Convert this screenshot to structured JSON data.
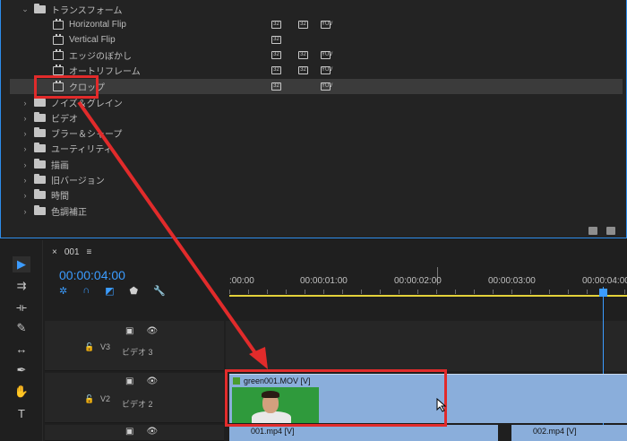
{
  "effects": {
    "folders_top": [
      {
        "label": "トランスフォーム",
        "expanded": true
      }
    ],
    "items": [
      {
        "label": "Horizontal Flip",
        "badges": [
          "32",
          "32",
          "YUV"
        ]
      },
      {
        "label": "Vertical Flip",
        "badges": [
          "32"
        ]
      },
      {
        "label": "エッジのぼかし",
        "badges": [
          "32",
          "32",
          "YUV"
        ]
      },
      {
        "label": "オートリフレーム",
        "badges": [
          "32",
          "32",
          "YUV"
        ]
      },
      {
        "label": "クロップ",
        "badges": [
          "32",
          "YUV"
        ],
        "selected": true
      }
    ],
    "folders": [
      "ノイズ＆グレイン",
      "ビデオ",
      "ブラー＆シャープ",
      "ユーティリティ",
      "描画",
      "旧バージョン",
      "時間",
      "色調補正"
    ]
  },
  "timeline": {
    "tab": {
      "close": "×",
      "name": "001",
      "menu": "≡"
    },
    "timecode": "00:00:04:00",
    "ruler_labels": [
      ":00:00",
      "00:00:01:00",
      "00:00:02:00",
      "00:00:03:00",
      "00:00:04:00"
    ],
    "tracks": [
      {
        "id": "V3",
        "label": "ビデオ 3"
      },
      {
        "id": "V2",
        "label": "ビデオ 2"
      }
    ],
    "clips": {
      "v2": "green001.MOV [V]",
      "v1a": "001.mp4 [V]",
      "v1b": "002.mp4 [V]"
    }
  },
  "tools": [
    "selection-tool",
    "track-select-tool",
    "ripple-edit-tool",
    "razor-tool",
    "slip-tool",
    "pen-tool",
    "hand-tool",
    "type-tool"
  ],
  "colors": {
    "accent": "#3b9cff",
    "annotation": "#e12b2b",
    "clip": "#8aaedb",
    "ruler": "#e3d13a"
  }
}
